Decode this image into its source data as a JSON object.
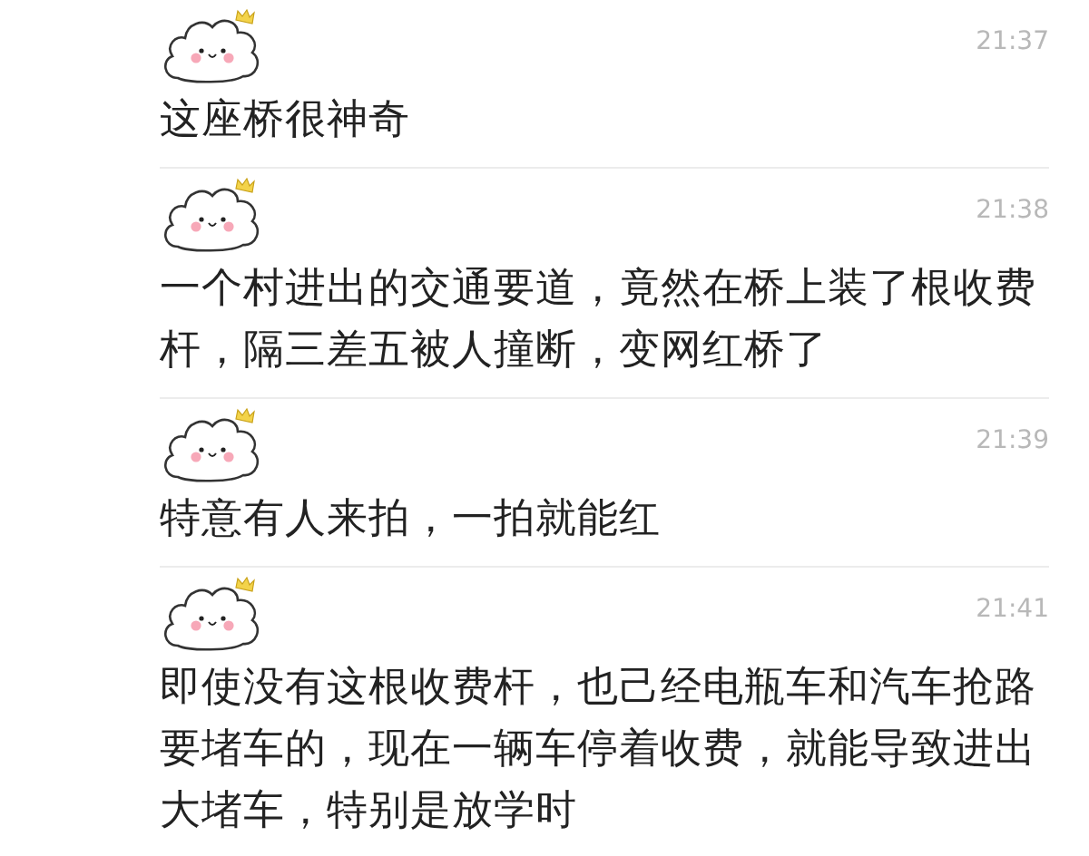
{
  "messages": [
    {
      "time": "21:37",
      "text": "这座桥很神奇"
    },
    {
      "time": "21:38",
      "text": "一个村进出的交通要道，竟然在桥上装了根收费杆，隔三差五被人撞断，变网红桥了"
    },
    {
      "time": "21:39",
      "text": "特意有人来拍，一拍就能红"
    },
    {
      "time": "21:41",
      "text": "即使没有这根收费杆，也己经电瓶车和汽车抢路要堵车的，现在一辆车停着收费，就能导致进出大堵车，特别是放学时"
    }
  ]
}
